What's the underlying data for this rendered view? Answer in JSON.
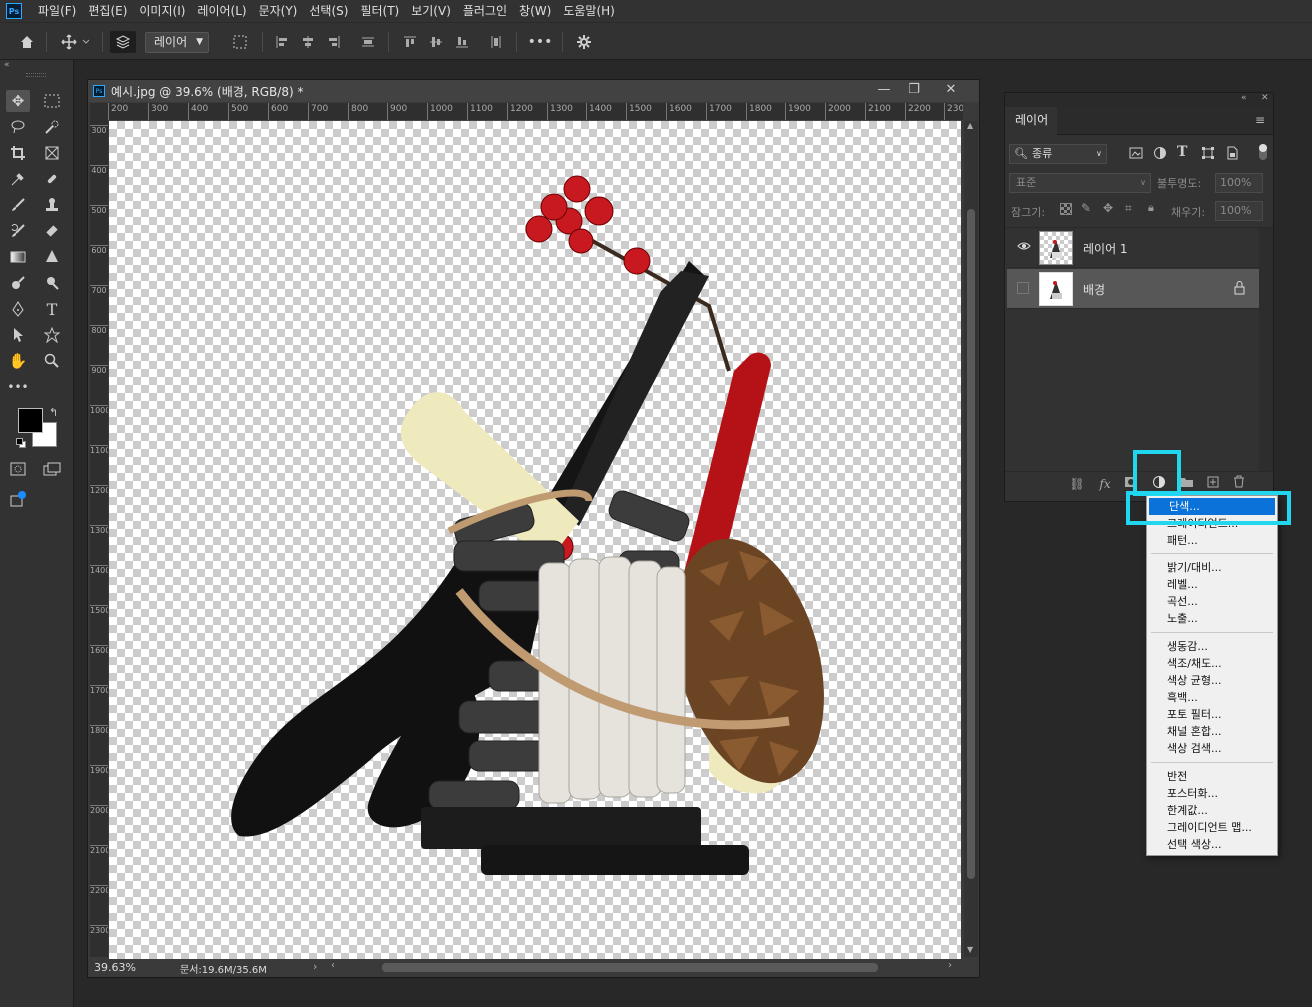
{
  "app": {
    "logo": "Ps",
    "menu": [
      "파일(F)",
      "편집(E)",
      "이미지(I)",
      "레이어(L)",
      "문자(Y)",
      "선택(S)",
      "필터(T)",
      "보기(V)",
      "플러그인",
      "창(W)",
      "도움말(H)"
    ]
  },
  "options_bar": {
    "layer_select_value": "레이어"
  },
  "document": {
    "title": "예시.jpg @ 39.6% (배경, RGB/8) *",
    "ruler_h": [
      "200",
      "300",
      "400",
      "500",
      "600",
      "700",
      "800",
      "900",
      "1000",
      "1100",
      "1200",
      "1300",
      "1400",
      "1500",
      "1600",
      "1700",
      "1800",
      "1900",
      "2000",
      "2100",
      "2200",
      "230"
    ],
    "ruler_v": [
      "300",
      "400",
      "500",
      "600",
      "700",
      "800",
      "900",
      "1000",
      "1100",
      "1200",
      "1300",
      "1400",
      "1500",
      "1600",
      "1700",
      "1800",
      "1900",
      "2000",
      "2100",
      "2200",
      "2300"
    ],
    "zoom": "39.63%",
    "doc_size": "문서:19.6M/35.6M"
  },
  "layers_panel": {
    "tab": "레이어",
    "filter_kind": "종류",
    "blend_mode": "표준",
    "opacity_label": "불투명도:",
    "opacity_value": "100%",
    "lock_label": "잠그기:",
    "fill_label": "채우기:",
    "fill_value": "100%",
    "layers": [
      {
        "name": "레이어 1",
        "visible": true,
        "locked": false
      },
      {
        "name": "배경",
        "visible": false,
        "locked": true
      }
    ]
  },
  "adjustment_menu": {
    "groups": [
      [
        "단색...",
        "그레이디언트...",
        "패턴..."
      ],
      [
        "밝기/대비...",
        "레벨...",
        "곡선...",
        "노출..."
      ],
      [
        "생동감...",
        "색조/채도...",
        "색상 균형...",
        "흑백...",
        "포토 필터...",
        "채널 혼합...",
        "색상 검색..."
      ],
      [
        "반전",
        "포스터화...",
        "한계값...",
        "그레이디언트 맵...",
        "선택 색상..."
      ]
    ],
    "active_item": "단색..."
  },
  "colors": {
    "highlight": "#21d7f0",
    "menu_active": "#0a72d8"
  }
}
